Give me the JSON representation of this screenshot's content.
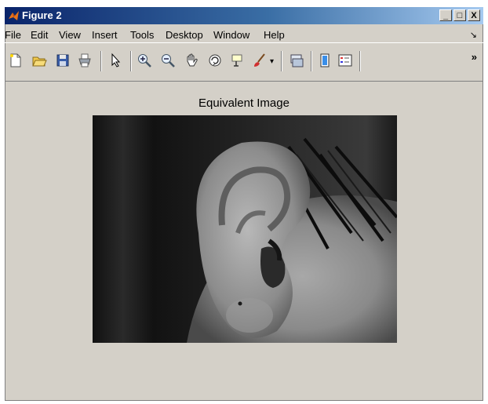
{
  "window": {
    "title": "Figure 2"
  },
  "title_buttons": {
    "minimize": "_",
    "maximize": "□",
    "close": "X"
  },
  "menu": [
    {
      "label": "File"
    },
    {
      "label": "Edit"
    },
    {
      "label": "View"
    },
    {
      "label": "Insert"
    },
    {
      "label": "Tools"
    },
    {
      "label": "Desktop"
    },
    {
      "label": "Window"
    },
    {
      "label": "Help"
    }
  ],
  "menu_arrow": "↘",
  "toolbar": {
    "tools": [
      {
        "name": "new-figure"
      },
      {
        "name": "open-file"
      },
      {
        "name": "save-figure"
      },
      {
        "name": "print-figure"
      },
      {
        "name": "edit-plot-arrow"
      },
      {
        "name": "zoom-in"
      },
      {
        "name": "zoom-out"
      },
      {
        "name": "pan-hand"
      },
      {
        "name": "rotate-3d"
      },
      {
        "name": "data-cursor"
      },
      {
        "name": "brush"
      },
      {
        "name": "link-plot"
      },
      {
        "name": "insert-colorbar"
      },
      {
        "name": "insert-legend"
      }
    ],
    "overflow": "»"
  },
  "axes": {
    "title": "Equivalent Image"
  },
  "image": {
    "subject": "grayscale photo of an ear",
    "colors": {
      "background": "#d4d0c8",
      "image_dark": "#0d0d0d"
    }
  }
}
